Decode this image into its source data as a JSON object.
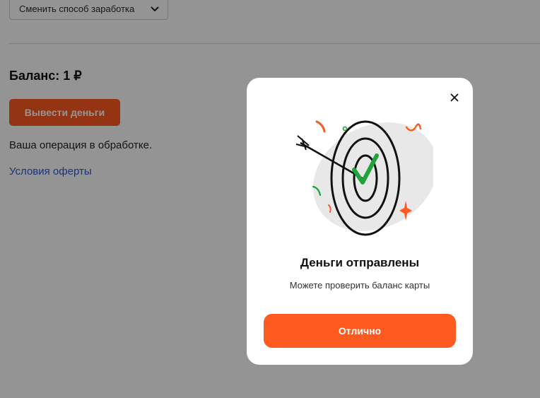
{
  "top_bar": {
    "change_method_label": "Сменить способ заработка"
  },
  "balance": {
    "label": "Баланс: 1 ₽"
  },
  "withdraw_button": {
    "label": "Вывести деньги"
  },
  "status_text": "Ваша операция в обработке.",
  "offer_link": "Условия оферты",
  "modal": {
    "title": "Деньги отправлены",
    "subtitle": "Можете проверить баланс карты",
    "ok_button": "Отлично"
  },
  "colors": {
    "accent": "#ff5a1f",
    "link": "#2a5bd7",
    "success": "#1fa33a"
  }
}
